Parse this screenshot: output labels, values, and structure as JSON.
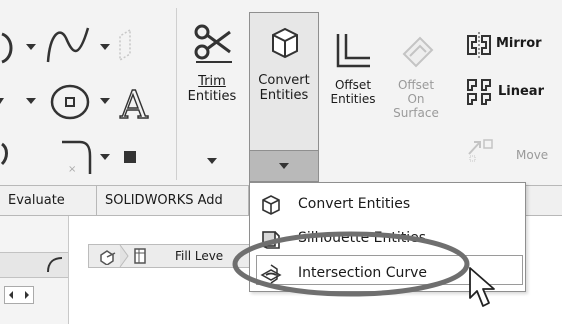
{
  "ribbon": {
    "trim_entities": {
      "line1": "Trim",
      "line2": "Entities"
    },
    "convert_entities": {
      "line1": "Convert",
      "line2": "Entities"
    },
    "offset_entities": {
      "line1": "Offset",
      "line2": "Entities"
    },
    "offset_on_surface": {
      "line1": "Offset",
      "line2": "On",
      "line3": "Surface"
    },
    "mirror_label": "Mirror",
    "linear_label": "Linear",
    "move_label": "Move"
  },
  "tabs": [
    {
      "label": "Evaluate"
    },
    {
      "label": "SOLIDWORKS Add"
    }
  ],
  "breadcrumb": {
    "label": "Fill Leve"
  },
  "dropdown": {
    "items": [
      {
        "label": "Convert Entities",
        "icon": "convert-entities-icon"
      },
      {
        "label": "Silhouette Entities",
        "icon": "silhouette-entities-icon"
      },
      {
        "label": "Intersection Curve",
        "icon": "intersection-curve-icon"
      }
    ]
  },
  "colors": {
    "ribbon_bg": "#f3f3f3",
    "selected_button_bg": "#e7e7e7",
    "split_arrow_bg": "#b9b9b9",
    "annotation_ellipse": "#6f6f6f"
  }
}
